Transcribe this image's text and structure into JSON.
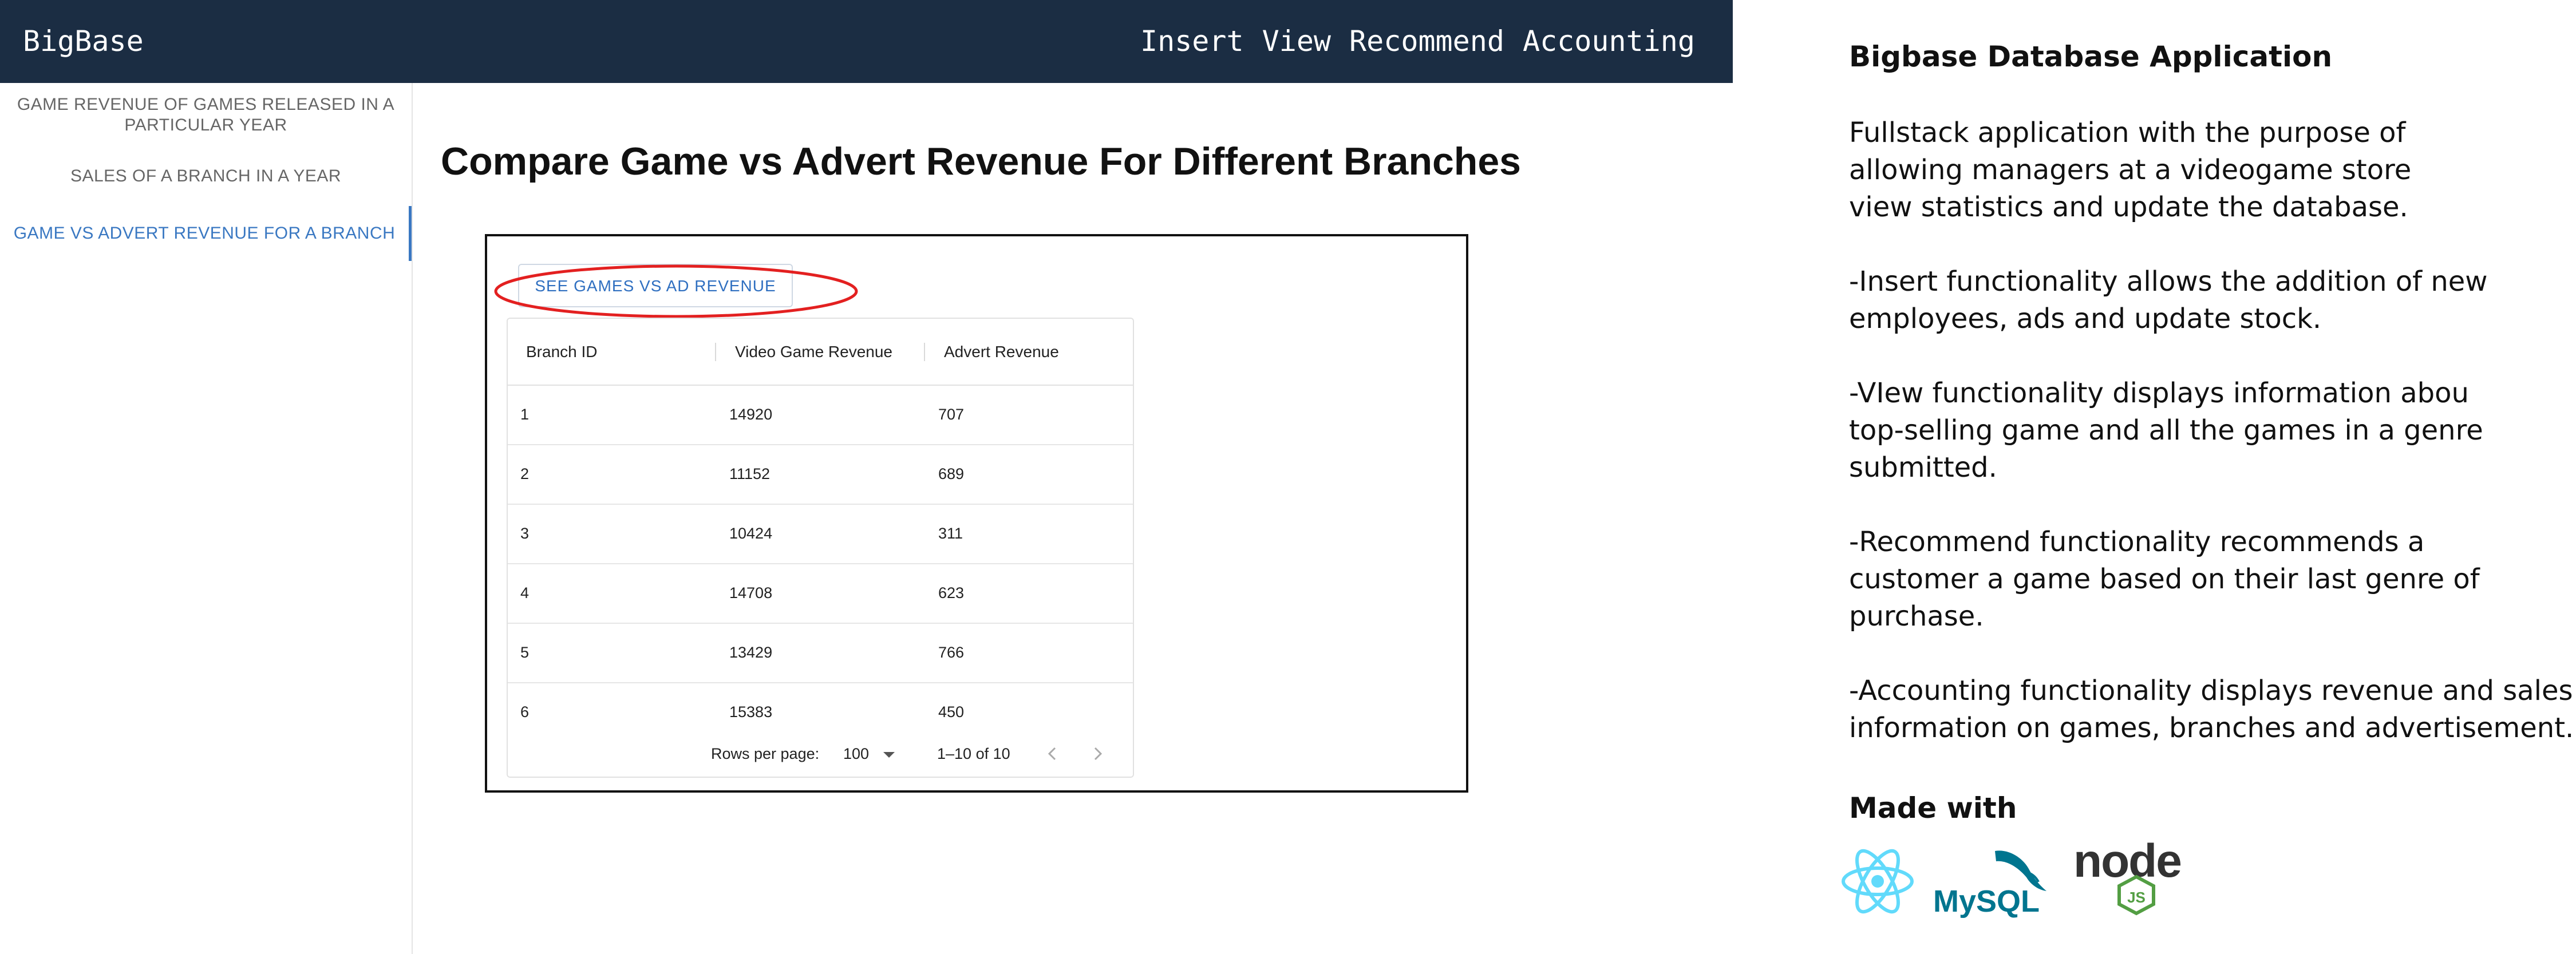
{
  "header": {
    "brand": "BigBase",
    "nav": [
      "Insert",
      "View",
      "Recommend",
      "Accounting"
    ]
  },
  "sidebar": {
    "items": [
      {
        "lines": [
          "GAME REVENUE OF GAMES RELEASED IN A",
          "PARTICULAR YEAR"
        ],
        "active": false
      },
      {
        "lines": [
          "SALES OF A BRANCH IN A YEAR"
        ],
        "active": false
      },
      {
        "lines": [
          "GAME VS ADVERT REVENUE FOR A BRANCH"
        ],
        "active": true
      }
    ]
  },
  "main": {
    "title": "Compare Game vs Advert Revenue For Different Branches",
    "button_label": "SEE GAMES VS AD REVENUE",
    "highlight_color": "#e32020",
    "table": {
      "columns": [
        "Branch ID",
        "Video Game Revenue",
        "Advert Revenue"
      ],
      "rows": [
        [
          "1",
          "14920",
          "707"
        ],
        [
          "2",
          "11152",
          "689"
        ],
        [
          "3",
          "10424",
          "311"
        ],
        [
          "4",
          "14708",
          "623"
        ],
        [
          "5",
          "13429",
          "766"
        ],
        [
          "6",
          "15383",
          "450"
        ]
      ]
    },
    "pagination": {
      "rows_per_page_label": "Rows per page:",
      "rows_per_page_value": "100",
      "range": "1–10 of 10"
    }
  },
  "info": {
    "title": "Bigbase Database Application",
    "paragraphs": [
      [
        "Fullstack application with the purpose of",
        "allowing managers at a videogame store",
        "view statistics and update the database."
      ],
      [
        "-Insert functionality allows the addition of new",
        "employees, ads and update stock."
      ],
      [
        "-VIew functionality displays information abou",
        "top-selling game and all the games in a genre",
        "submitted."
      ],
      [
        "-Recommend functionality recommends a",
        "customer a game based on their last genre of",
        "purchase."
      ],
      [
        "-Accounting functionality displays revenue and sales",
        "information on games, branches and advertisement."
      ]
    ],
    "made_with_title": "Made with",
    "logos": [
      "react-logo",
      "mysql-logo",
      "nodejs-logo"
    ],
    "logo_text": {
      "mysql": "MySQL",
      "node": "node",
      "js": "JS"
    }
  },
  "colors": {
    "header_bg": "#1b2d43",
    "accent": "#3a78c2",
    "react": "#61dafb",
    "mysql_blue": "#00758f",
    "mysql_orange": "#f29111",
    "node_green": "#539e43"
  }
}
